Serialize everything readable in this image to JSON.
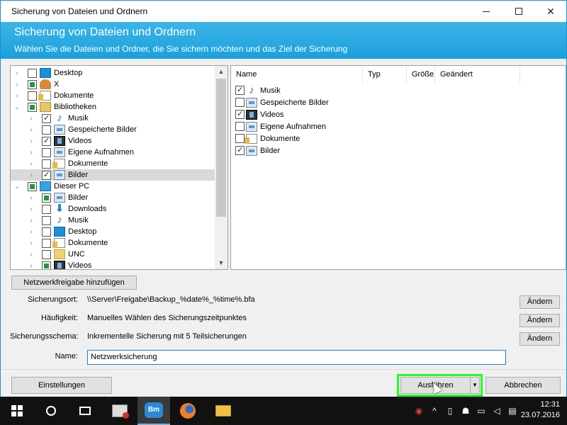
{
  "window": {
    "title": "Sicherung von Dateien und Ordnern",
    "header_title": "Sicherung von Dateien und Ordnern",
    "header_subtitle": "Wählen Sie die Dateien und Ordner, die Sie sichern möchten und das Ziel der Sicherung"
  },
  "tree": {
    "items": [
      {
        "label": "Desktop",
        "icon": "desktop-icon",
        "level": 0,
        "state": "unchecked",
        "selected": false
      },
      {
        "label": "X",
        "icon": "user-icon",
        "level": 0,
        "state": "partial",
        "selected": false
      },
      {
        "label": "Dokumente",
        "icon": "documents-icon",
        "level": 0,
        "state": "unchecked",
        "selected": false
      },
      {
        "label": "Bibliotheken",
        "icon": "library-icon",
        "level": 0,
        "state": "partial",
        "selected": false,
        "expanded": true
      },
      {
        "label": "Musik",
        "icon": "music-icon",
        "level": 1,
        "state": "checked",
        "selected": false
      },
      {
        "label": "Gespeicherte Bilder",
        "icon": "pictures-icon",
        "level": 1,
        "state": "unchecked",
        "selected": false
      },
      {
        "label": "Videos",
        "icon": "video-icon",
        "level": 1,
        "state": "checked",
        "selected": false
      },
      {
        "label": "Eigene Aufnahmen",
        "icon": "pictures-icon",
        "level": 1,
        "state": "unchecked",
        "selected": false
      },
      {
        "label": "Dokumente",
        "icon": "documents-icon",
        "level": 1,
        "state": "unchecked",
        "selected": false
      },
      {
        "label": "Bilder",
        "icon": "pictures-icon",
        "level": 1,
        "state": "checked",
        "selected": true
      },
      {
        "label": "Dieser PC",
        "icon": "pc-icon",
        "level": 0,
        "state": "partial",
        "selected": false,
        "expanded": true
      },
      {
        "label": "Bilder",
        "icon": "pictures-icon",
        "level": 1,
        "state": "partial",
        "selected": false
      },
      {
        "label": "Downloads",
        "icon": "download-icon",
        "level": 1,
        "state": "unchecked",
        "selected": false
      },
      {
        "label": "Musik",
        "icon": "music-icon",
        "level": 1,
        "state": "unchecked",
        "selected": false
      },
      {
        "label": "Desktop",
        "icon": "desktop-icon",
        "level": 1,
        "state": "unchecked",
        "selected": false
      },
      {
        "label": "Dokumente",
        "icon": "documents-icon",
        "level": 1,
        "state": "unchecked",
        "selected": false
      },
      {
        "label": "UNC",
        "icon": "folder-icon",
        "level": 1,
        "state": "unchecked",
        "selected": false
      },
      {
        "label": "Videos",
        "icon": "video-icon",
        "level": 1,
        "state": "partial",
        "selected": false
      }
    ]
  },
  "files": {
    "columns": [
      "Name",
      "Typ",
      "Größe",
      "Geändert"
    ],
    "rows": [
      {
        "label": "Musik",
        "icon": "music-icon",
        "checked": true
      },
      {
        "label": "Gespeicherte Bilder",
        "icon": "pictures-icon",
        "checked": false
      },
      {
        "label": "Videos",
        "icon": "video-icon",
        "checked": true
      },
      {
        "label": "Eigene Aufnahmen",
        "icon": "pictures-icon",
        "checked": false
      },
      {
        "label": "Dokumente",
        "icon": "documents-icon",
        "checked": false
      },
      {
        "label": "Bilder",
        "icon": "pictures-icon",
        "checked": true
      }
    ]
  },
  "add_network_label": "Netzwerkfreigabe hinzufügen",
  "fields": {
    "location_label": "Sicherungsort:",
    "location_value": "\\\\Server\\Freigabe\\Backup_%date%_%time%.bfa",
    "frequency_label": "Häufigkeit:",
    "frequency_value": "Manuelles Wählen des Sicherungszeitpunktes",
    "scheme_label": "Sicherungsschema:",
    "scheme_value": "Inkrementelle Sicherung mit 5 Teilsicherungen",
    "change_label": "Ändern",
    "name_label": "Name:",
    "name_value": "Netzwerksicherung"
  },
  "footer": {
    "settings_label": "Einstellungen",
    "run_label": "Ausführen",
    "cancel_label": "Abbrechen"
  },
  "taskbar": {
    "time": "12:31",
    "date": "23.07.2016",
    "app2_text": "Bm"
  },
  "colors": {
    "header": "#1aa0dc",
    "highlight": "#22ff22"
  }
}
